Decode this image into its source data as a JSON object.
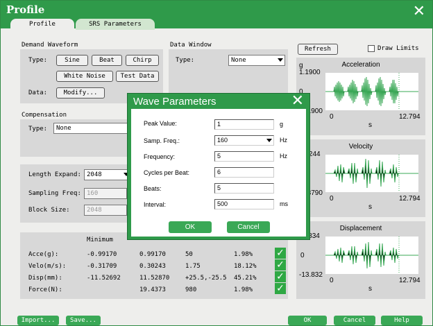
{
  "window": {
    "title": "Profile",
    "close_glyph": "✕"
  },
  "tabs": [
    {
      "label": "Profile"
    },
    {
      "label": "SRS Parameters"
    }
  ],
  "demand": {
    "heading": "Demand Waveform",
    "type_label": "Type:",
    "buttons": [
      "Sine",
      "Beat",
      "Chirp",
      "White Noise",
      "Test Data"
    ],
    "data_label": "Data:",
    "modify_label": "Modify..."
  },
  "data_window": {
    "heading": "Data Window",
    "type_label": "Type:",
    "value": "None"
  },
  "compensation": {
    "heading": "Compensation",
    "type_label": "Type:",
    "value": "None"
  },
  "params": {
    "length_label": "Length Expand:",
    "length_value": "2048",
    "freq_label": "Sampling Freq:",
    "freq_value": "160",
    "block_label": "Block Size:",
    "block_value": "2048"
  },
  "stats": {
    "header_min": "Minimum",
    "rows": [
      {
        "label": "Acce(g):",
        "min": "-0.99170",
        "max": "0.99170",
        "c3": "50",
        "pct": "1.98%"
      },
      {
        "label": "Velo(m/s):",
        "min": "-0.31709",
        "max": "0.30243",
        "c3": "1.75",
        "pct": "18.12%"
      },
      {
        "label": "Disp(mm):",
        "min": "-11.52692",
        "max": "11.52870",
        "c3": "+25.5,-25.5",
        "pct": "45.21%"
      },
      {
        "label": "Force(N):",
        "min": "",
        "max": "19.4373",
        "c3": "980",
        "pct": "1.98%"
      }
    ]
  },
  "right": {
    "refresh_label": "Refresh",
    "draw_limits_label": "Draw Limits"
  },
  "charts": [
    {
      "title": "Acceleration",
      "unit": "g",
      "ytop": "1.1900",
      "ymid": "0",
      "ybot": "-1.1900",
      "xmin": "0",
      "xmax": "12.794",
      "xlabel": "s"
    },
    {
      "title": "Velocity",
      "ytop": "0.3244",
      "ybot": "-0.3790",
      "xmin": "0",
      "xmax": "12.794",
      "xlabel": "s"
    },
    {
      "title": "Displacement",
      "ytop": "11.834",
      "ymid": "0",
      "ybot": "-13.832",
      "xmin": "0",
      "xmax": "12.794",
      "xlabel": "s"
    }
  ],
  "dialog": {
    "title": "Wave Parameters",
    "close_glyph": "✕",
    "fields": [
      {
        "label": "Peak Value:",
        "value": "1",
        "unit": "g"
      },
      {
        "label": "Samp. Freq.:",
        "value": "160",
        "unit": "Hz"
      },
      {
        "label": "Frequency:",
        "value": "5",
        "unit": "Hz"
      },
      {
        "label": "Cycles per Beat:",
        "value": "6",
        "unit": ""
      },
      {
        "label": "Beats:",
        "value": "5",
        "unit": ""
      },
      {
        "label": "Interval:",
        "value": "500",
        "unit": "ms"
      }
    ],
    "ok_label": "OK",
    "cancel_label": "Cancel"
  },
  "footer": {
    "import_label": "Import...",
    "save_label": "Save...",
    "ok_label": "OK",
    "cancel_label": "Cancel",
    "help_label": "Help"
  },
  "colors": {
    "brand_green": "#2f9a4a",
    "plot_green": "#3aa856"
  }
}
